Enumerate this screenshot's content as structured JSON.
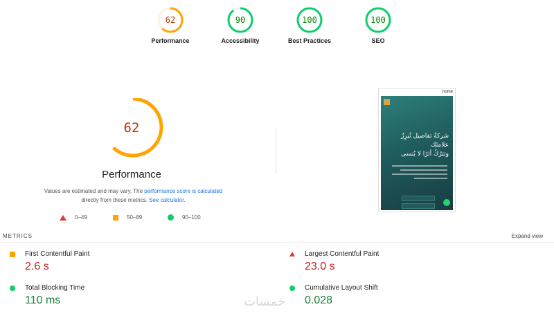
{
  "categories": [
    {
      "score": "62",
      "label": "Performance",
      "color": "#ffa400",
      "fraction": 0.62
    },
    {
      "score": "90",
      "label": "Accessibility",
      "color": "#0cce6b",
      "fraction": 0.9
    },
    {
      "score": "100",
      "label": "Best Practices",
      "color": "#0cce6b",
      "fraction": 1.0
    },
    {
      "score": "100",
      "label": "SEO",
      "color": "#0cce6b",
      "fraction": 1.0
    }
  ],
  "main": {
    "score": "62",
    "fraction": 0.62,
    "color": "#ffa400",
    "title": "Performance",
    "note_pre": "Values are estimated and may vary. The ",
    "note_link1": "performance score is calculated",
    "note_mid": " directly from these metrics. ",
    "note_link2": "See calculator",
    "note_post": "."
  },
  "legend": {
    "fail": "0–49",
    "average": "50–89",
    "pass": "90–100"
  },
  "thumbnail": {
    "top_text": "home",
    "heading_line1": "شركةُ تفاصيل تُبرِزُ",
    "heading_line2": "علامتَك",
    "heading_line3": "وتترُكُ أثرًا لا يُنسى"
  },
  "metrics": {
    "title": "METRICS",
    "expand_label": "Expand view",
    "fcp": {
      "label": "First Contentful Paint",
      "value": "2.6 s"
    },
    "lcp": {
      "label": "Largest Contentful Paint",
      "value": "23.0 s"
    },
    "tbt": {
      "label": "Total Blocking Time",
      "value": "110 ms"
    },
    "cls": {
      "label": "Cumulative Layout Shift",
      "value": "0.028"
    }
  },
  "watermark": "خمسات"
}
